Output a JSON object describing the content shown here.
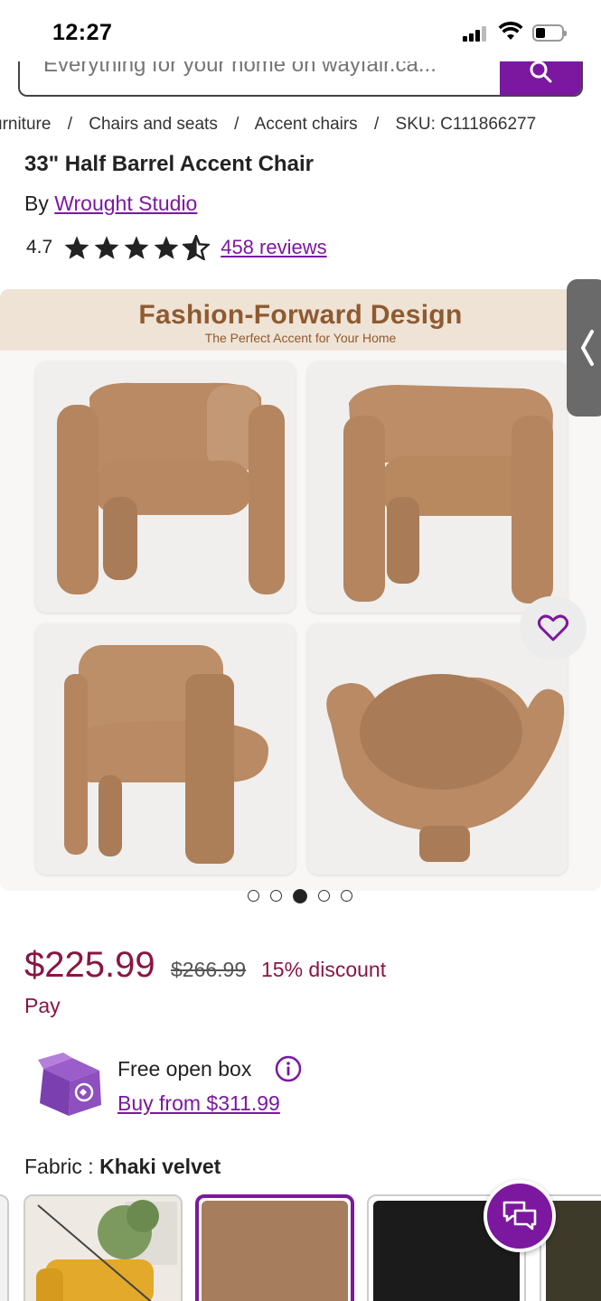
{
  "status_bar": {
    "time": "12:27"
  },
  "search": {
    "placeholder": "Everything for your home on wayfair.ca..."
  },
  "breadcrumb": {
    "items": [
      "urniture",
      "Chairs and seats",
      "Accent chairs",
      "SKU: C111866277"
    ]
  },
  "product": {
    "title": "33\" Half Barrel Accent Chair",
    "by_label": "By",
    "brand": "Wrought Studio",
    "rating": "4.7",
    "rating_value": 4.7,
    "reviews": "458 reviews"
  },
  "gallery": {
    "banner_title": "Fashion-Forward Design",
    "banner_subtitle": "The Perfect Accent for Your Home",
    "dots_total": 5,
    "dots_active_index": 2
  },
  "pricing": {
    "price": "$225.99",
    "old_price": "$266.99",
    "discount": "15% discount",
    "pay_label": "Pay"
  },
  "open_box": {
    "title": "Free open box",
    "link": "Buy from $311.99"
  },
  "fabric": {
    "label": "Fabric : ",
    "selected": "Khaki velvet",
    "swatches": [
      "unavailable-yellow",
      "khaki",
      "black",
      "olive"
    ]
  },
  "colors": {
    "accent": "#7b189f",
    "price": "#8a1544",
    "banner_bg": "#efe3d6",
    "chair": "#b98a63"
  }
}
